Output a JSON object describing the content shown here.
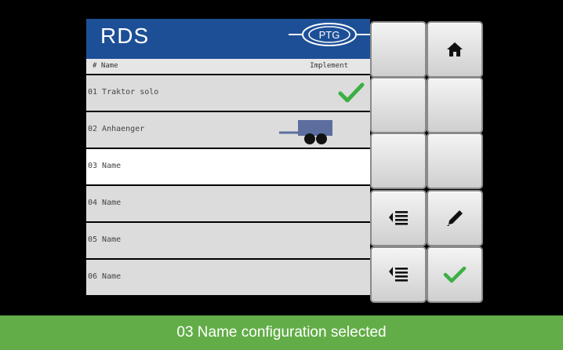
{
  "screen": {
    "app_title": "RDS",
    "logo_text": "PTG",
    "columns": {
      "number_name": "# Name",
      "implement": "Implement"
    },
    "rows": [
      {
        "label": "01 Traktor solo",
        "icon": "check-icon",
        "selected": false
      },
      {
        "label": "02 Anhaenger",
        "icon": "trailer-icon",
        "selected": false
      },
      {
        "label": "03 Name",
        "icon": "",
        "selected": true
      },
      {
        "label": "04 Name",
        "icon": "",
        "selected": false
      },
      {
        "label": "05 Name",
        "icon": "",
        "selected": false
      },
      {
        "label": "06 Name",
        "icon": "",
        "selected": false
      }
    ],
    "buttons": [
      {
        "name": "blank-button-1",
        "icon": ""
      },
      {
        "name": "home-button",
        "icon": "home-icon"
      },
      {
        "name": "blank-button-2",
        "icon": ""
      },
      {
        "name": "blank-button-3",
        "icon": ""
      },
      {
        "name": "blank-button-4",
        "icon": ""
      },
      {
        "name": "blank-button-5",
        "icon": ""
      },
      {
        "name": "move-up-button",
        "icon": "move-up-icon"
      },
      {
        "name": "edit-button",
        "icon": "pencil-icon"
      },
      {
        "name": "move-down-button",
        "icon": "move-down-icon"
      },
      {
        "name": "confirm-button",
        "icon": "check-icon"
      }
    ],
    "colors": {
      "header": "#1d4f96",
      "accent_green": "#62ad47",
      "check_green": "#3cb043",
      "trailer": "#5b6e9e"
    }
  },
  "caption": "03 Name configuration selected"
}
